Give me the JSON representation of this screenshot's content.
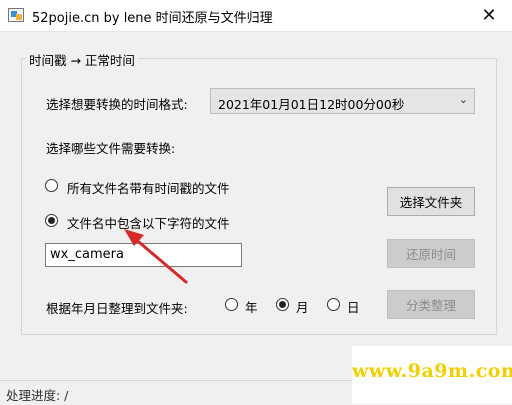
{
  "window": {
    "title": "52pojie.cn by lene 时间还原与文件归理",
    "close_glyph": "✕"
  },
  "group": {
    "legend": "时间戳 → 正常时间"
  },
  "format": {
    "label": "选择想要转换的时间格式:",
    "selected": "2021年01月01日12时00分00秒",
    "chevron": "⌄"
  },
  "files": {
    "label": "选择哪些文件需要转换:",
    "option_all": "所有文件名带有时间戳的文件",
    "option_contains": "文件名中包含以下字符的文件",
    "selected_option": "contains",
    "filter_value": "wx_camera"
  },
  "buttons": {
    "select_folder": "选择文件夹",
    "restore_time": "还原时间",
    "classify": "分类整理"
  },
  "organize": {
    "label": "根据年月日整理到文件夹:",
    "year": "年",
    "month": "月",
    "day": "日",
    "selected": "month"
  },
  "status": {
    "text": "处理进度: /"
  },
  "watermark": {
    "text": "www.9a9m.com"
  },
  "colors": {
    "annotation_arrow": "#d42a2a",
    "watermark": "#f0d000"
  }
}
